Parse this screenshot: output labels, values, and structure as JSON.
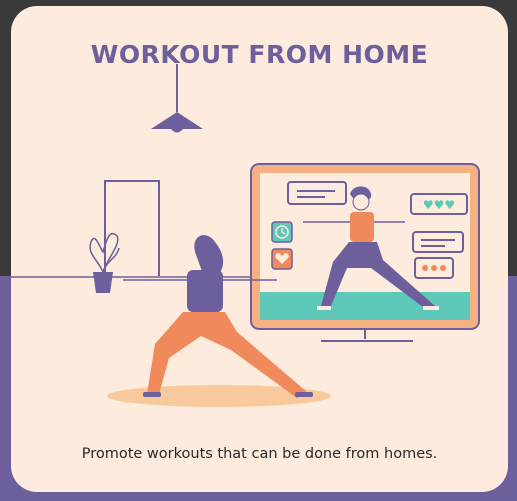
{
  "card": {
    "title": "WORKOUT FROM HOME",
    "caption": "Promote workouts that can be done from homes."
  },
  "icons": {
    "lamp": "ceiling-lamp-icon",
    "plant": "potted-plant-icon",
    "clock": "clock-icon",
    "heart": "heart-icon",
    "likes": "hearts-icon",
    "more": "more-dots-icon"
  },
  "colors": {
    "purple": "#6c5f9c",
    "cream": "#fdebdd",
    "orange": "#f08a5d",
    "teal": "#5ec9b8"
  }
}
